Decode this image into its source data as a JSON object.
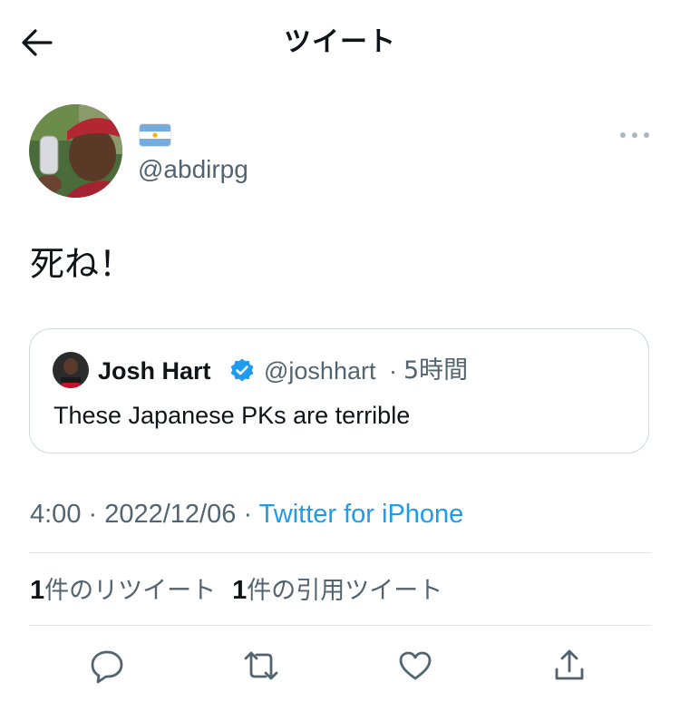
{
  "header": {
    "title": "ツイート",
    "back_icon": "arrow-left-icon"
  },
  "author": {
    "flag_icon": "argentina-flag-icon",
    "handle": "@abdirpg",
    "more_icon": "more-horizontal-icon"
  },
  "tweet": {
    "text": "死ね！"
  },
  "quoted_tweet": {
    "name": "Josh Hart",
    "verified_icon": "verified-badge-icon",
    "handle": "@joshhart",
    "separator": "·",
    "time": "5時間",
    "text": "These Japanese PKs are terrible"
  },
  "meta": {
    "time": "4:00",
    "sep1": " · ",
    "date": "2022/12/06",
    "sep2": " · ",
    "client": "Twitter for iPhone"
  },
  "stats": {
    "retweets_count": "1",
    "retweets_label": "件のリツイート",
    "quotes_count": "1",
    "quotes_label": "件の引用ツイート"
  },
  "actions": [
    "reply-icon",
    "retweet-icon",
    "like-icon",
    "share-icon"
  ],
  "colors": {
    "accent": "#1d9bf0",
    "secondary_text": "#536471",
    "border": "#cfd9de",
    "icon": "#536471"
  }
}
